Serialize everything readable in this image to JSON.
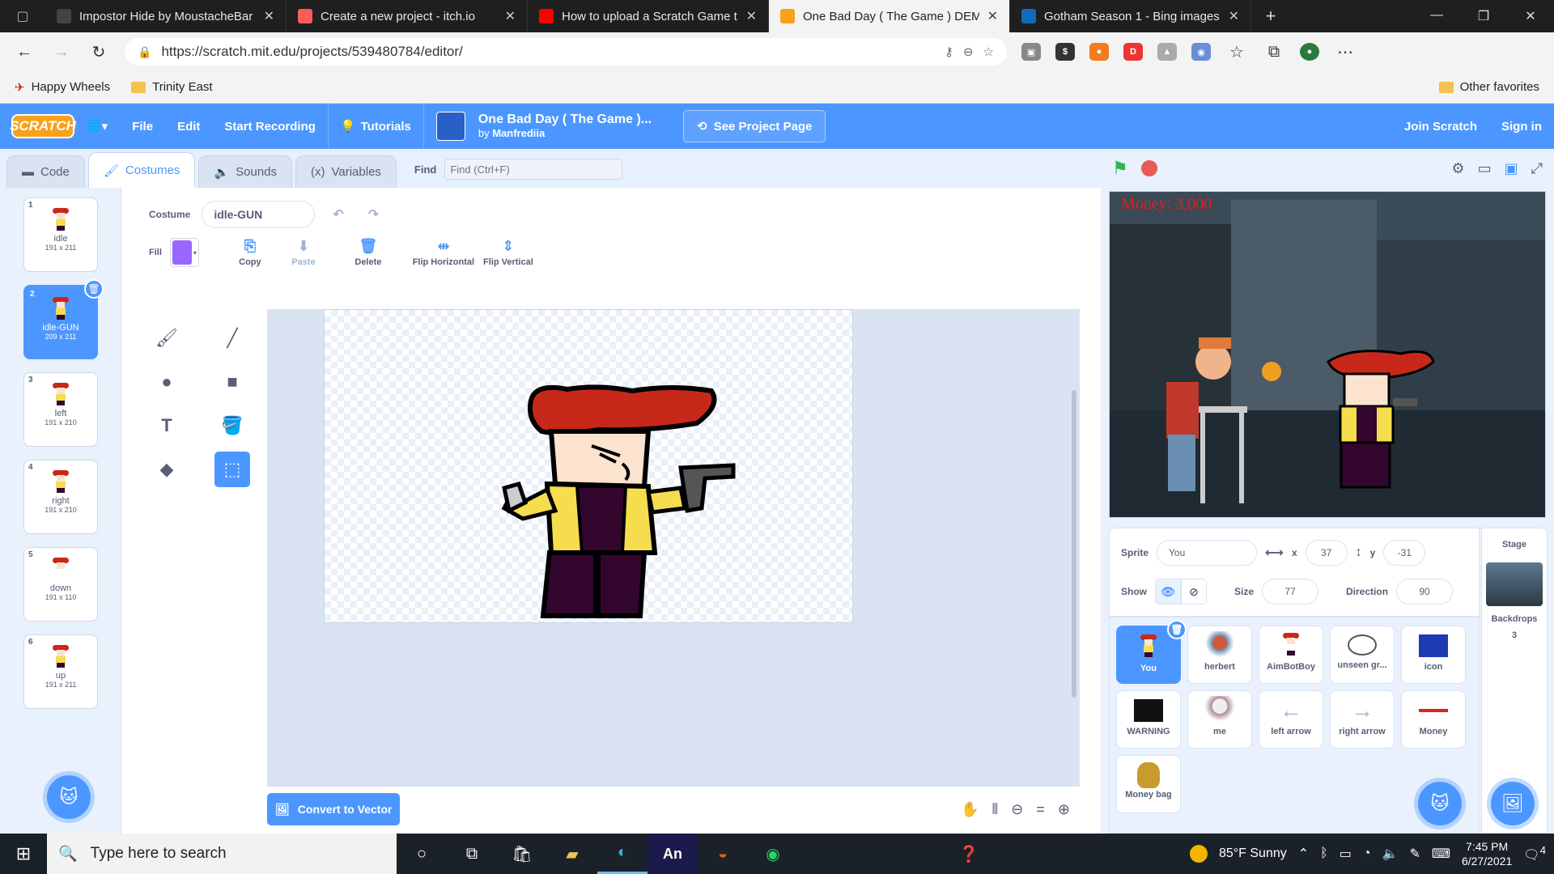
{
  "browser": {
    "tabs": [
      {
        "title": "Impostor Hide by MoustacheBar",
        "favicon_color": "#444444"
      },
      {
        "title": "Create a new project - itch.io",
        "favicon_color": "#fa5c5c"
      },
      {
        "title": "How to upload a Scratch Game t",
        "favicon_color": "#ff0000"
      },
      {
        "title": "One Bad Day ( The Game ) DEMO",
        "favicon_color": "#f8a21b"
      },
      {
        "title": "Gotham Season 1 - Bing images",
        "favicon_color": "#0f6cbd"
      }
    ],
    "active_tab": 3,
    "url": "https://scratch.mit.edu/projects/539480784/editor/",
    "favorites": [
      {
        "label": "Happy Wheels",
        "icon": "happy-wheels-icon"
      },
      {
        "label": "Trinity East",
        "icon": "folder-icon"
      }
    ],
    "other_favorites": "Other favorites"
  },
  "scratch": {
    "menu": {
      "logo": "SCRATCH",
      "file": "File",
      "edit": "Edit",
      "start_recording": "Start Recording",
      "tutorials": "Tutorials",
      "project_title": "One Bad Day ( The Game )...",
      "by_prefix": "by",
      "author": "Manfrediia",
      "see_project_page": "See Project Page",
      "join": "Join Scratch",
      "sign_in": "Sign in"
    },
    "tabs": {
      "code": "Code",
      "costumes": "Costumes",
      "sounds": "Sounds",
      "variables": "Variables",
      "find_label": "Find",
      "find_placeholder": "Find (Ctrl+F)"
    },
    "costumes": [
      {
        "num": "1",
        "name": "idle",
        "dims": "191 x 211"
      },
      {
        "num": "2",
        "name": "idle-GUN",
        "dims": "209 x 211"
      },
      {
        "num": "3",
        "name": "left",
        "dims": "191 x 210"
      },
      {
        "num": "4",
        "name": "right",
        "dims": "191 x 210"
      },
      {
        "num": "5",
        "name": "down",
        "dims": "191 x 110"
      },
      {
        "num": "6",
        "name": "up",
        "dims": "191 x 211"
      }
    ],
    "selected_costume": 1,
    "paint": {
      "costume_label": "Costume",
      "costume_name": "idle-GUN",
      "fill_label": "Fill",
      "fill_color": "#9966ff",
      "copy": "Copy",
      "paste": "Paste",
      "delete": "Delete",
      "flip_h": "Flip Horizontal",
      "flip_v": "Flip Vertical",
      "convert": "Convert to Vector"
    },
    "stage": {
      "money_text": "Money: 3,000"
    },
    "sprite_info": {
      "sprite_label": "Sprite",
      "sprite_name": "You",
      "x_label": "x",
      "x": "37",
      "y_label": "y",
      "y": "-31",
      "show_label": "Show",
      "size_label": "Size",
      "size": "77",
      "direction_label": "Direction",
      "direction": "90"
    },
    "sprites": [
      {
        "name": "You",
        "thumb_color": "#c8281a"
      },
      {
        "name": "herbert",
        "thumb_color": "#d25a3a"
      },
      {
        "name": "AimBotBoy",
        "thumb_color": "#c8281a"
      },
      {
        "name": "unseen gr...",
        "thumb_color": "#555555"
      },
      {
        "name": "icon",
        "thumb_color": "#1e3bb3"
      },
      {
        "name": "WARNING",
        "thumb_color": "#111111"
      },
      {
        "name": "me",
        "thumb_color": "#aa8899"
      },
      {
        "name": "left arrow",
        "thumb_color": "#9fb3cf"
      },
      {
        "name": "right arrow",
        "thumb_color": "#9fb3cf"
      },
      {
        "name": "Money",
        "thumb_color": "#e0201d"
      },
      {
        "name": "Money bag",
        "thumb_color": "#c99a2e"
      }
    ],
    "stage_pane": {
      "title": "Stage",
      "backdrops_label": "Backdrops",
      "backdrops_count": "3"
    }
  },
  "taskbar": {
    "search_placeholder": "Type here to search",
    "weather": "85°F  Sunny",
    "time": "7:45 PM",
    "date": "6/27/2021",
    "notifications": "4"
  }
}
